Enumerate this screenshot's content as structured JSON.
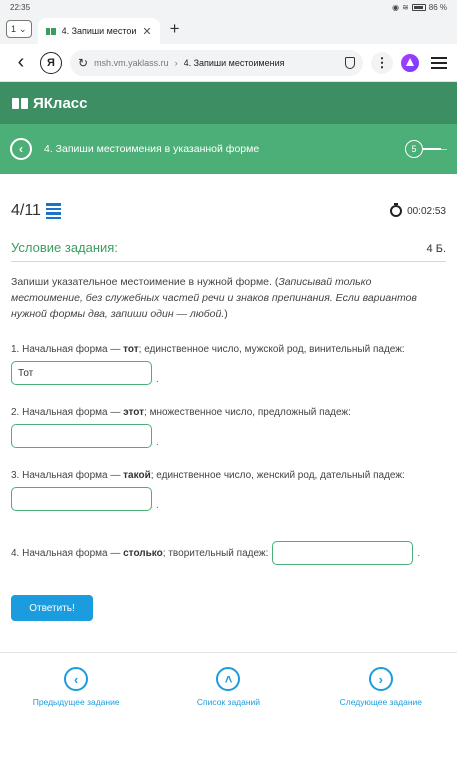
{
  "status": {
    "time": "22:35",
    "battery": "86 %"
  },
  "tabs": {
    "count": "1",
    "active_title": "4. Запиши местоим"
  },
  "address": {
    "domain": "msh.vm.yaklass.ru",
    "separator": "›",
    "title": "4. Запиши местоимения"
  },
  "site": {
    "logo": "ЯКласс"
  },
  "banner": {
    "title": "4. Запиши местоимения в указанной форме",
    "level": "5"
  },
  "task": {
    "counter": "4/11",
    "timer": "00:02:53",
    "condition_label": "Условие задания:",
    "points": "4 Б.",
    "instruction_main": "Запиши указательное местоимение в нужной форме. (",
    "instruction_italic": "Записывай только местоимение, без служебных частей речи и знаков препинания. Если вариантов нужной формы два, запиши один — любой.",
    "instruction_end": ")"
  },
  "questions": [
    {
      "prefix": "1. Начальная форма — ",
      "word": "тот",
      "suffix": "; единственное число, мужской род, винительный падеж:",
      "value": "Тот"
    },
    {
      "prefix": "2. Начальная форма — ",
      "word": "этот",
      "suffix": "; множественное число, предложный падеж:",
      "value": ""
    },
    {
      "prefix": "3. Начальная форма — ",
      "word": "такой",
      "suffix": "; единственное число, женский род, дательный падеж:",
      "value": ""
    },
    {
      "prefix": "4. Начальная форма — ",
      "word": "столько",
      "suffix": "; творительный падеж:",
      "value": ""
    }
  ],
  "answer_dot": ".",
  "submit_label": "Ответить!",
  "footer": {
    "prev": "Предыдущее задание",
    "list": "Список заданий",
    "next": "Следующее задание"
  }
}
